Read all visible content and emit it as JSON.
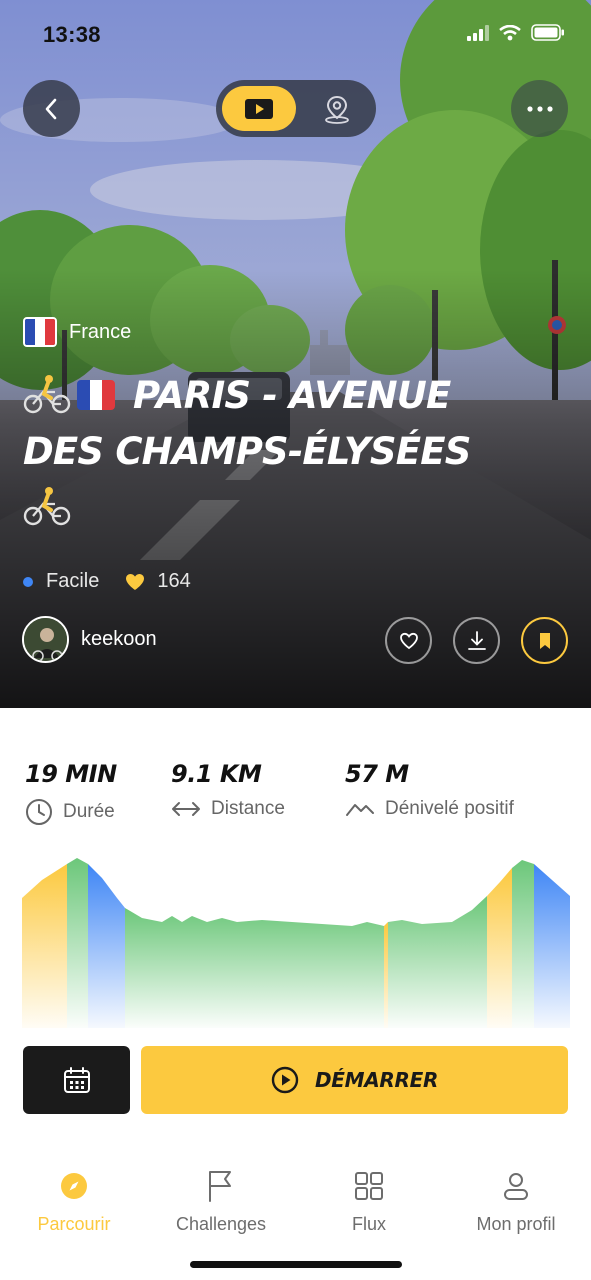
{
  "status_bar": {
    "time": "13:38"
  },
  "header": {
    "back_icon": "chevron-left-icon",
    "view_toggle": {
      "video_icon": "play-icon",
      "map_icon": "map-pin-icon",
      "selected": "video"
    },
    "more_icon": "more-dots-icon"
  },
  "route": {
    "country": "France",
    "title_part1": "PARIS - AVENUE",
    "title_part2": "DES CHAMPS-ÉLYSÉES",
    "difficulty": "Facile",
    "likes": "164",
    "author": "keekoon"
  },
  "stats": [
    {
      "value": "19 MIN",
      "label": "Durée",
      "icon": "clock-icon"
    },
    {
      "value": "9.1 KM",
      "label": "Distance",
      "icon": "arrows-horizontal-icon"
    },
    {
      "value": "57 M",
      "label": "Dénivelé positif",
      "icon": "mountain-icon"
    }
  ],
  "actions": {
    "calendar_icon": "calendar-icon",
    "start_label": "DÉMARRER"
  },
  "tabs": [
    {
      "label": "Parcourir",
      "icon": "compass-icon",
      "active": true
    },
    {
      "label": "Challenges",
      "icon": "flag-icon",
      "active": false
    },
    {
      "label": "Flux",
      "icon": "grid-icon",
      "active": false
    },
    {
      "label": "Mon profil",
      "icon": "user-icon",
      "active": false
    }
  ],
  "colors": {
    "accent": "#fcc93f",
    "difficulty_dot": "#3f86f5",
    "elevation_green": "#6cc77a",
    "elevation_yellow": "#fcc93f",
    "elevation_blue": "#3f86f5",
    "dark_button": "#1b1b1b"
  }
}
